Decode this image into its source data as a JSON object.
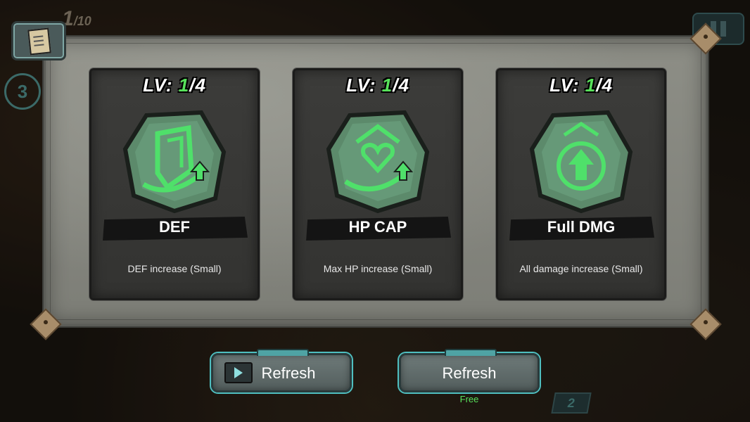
{
  "hud": {
    "wave_current": "1",
    "wave_total": "/10",
    "side_counter": "3",
    "bottom_badge": "2"
  },
  "cards": [
    {
      "lv_prefix": "LV: ",
      "lv_current": "1",
      "lv_max": "/4",
      "name": "DEF",
      "description": "DEF increase (Small)",
      "icon": "shield-upgrade-icon"
    },
    {
      "lv_prefix": "LV: ",
      "lv_current": "1",
      "lv_max": "/4",
      "name": "HP CAP",
      "description": "Max HP increase (Small)",
      "icon": "heart-upgrade-icon"
    },
    {
      "lv_prefix": "LV: ",
      "lv_current": "1",
      "lv_max": "/4",
      "name": "Full DMG",
      "description": "All damage increase (Small)",
      "icon": "damage-upgrade-icon"
    }
  ],
  "buttons": {
    "refresh_ad_label": "Refresh",
    "refresh_free_label": "Refresh",
    "refresh_free_caption": "Free"
  },
  "colors": {
    "level_current": "#58e25b",
    "gem_glow": "#4fe06a",
    "button_accent": "#4fbfc0"
  }
}
